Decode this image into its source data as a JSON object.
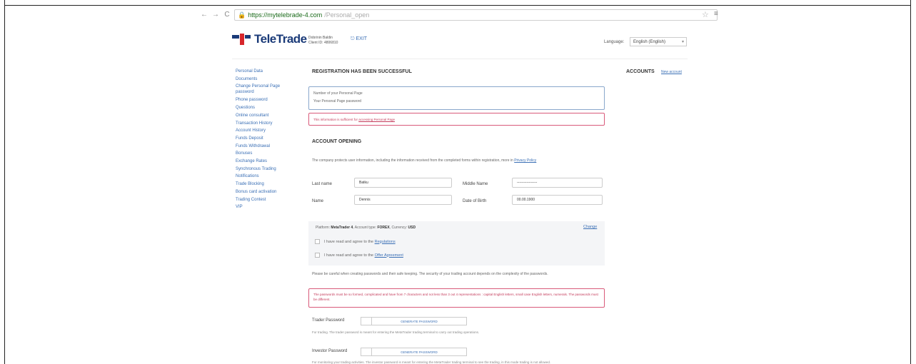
{
  "browser": {
    "back": "←",
    "forward": "→",
    "reload": "C",
    "url_host": "https://mytelebrade-4.com",
    "url_path": "/Personal_open",
    "star": "☆",
    "menu": "≡"
  },
  "header": {
    "logo_text": "TeleTrade",
    "user_line1": "Dobrinin Baldin",
    "user_line2": "Client ID: 4806810",
    "exit_label": "EXIT",
    "language_label": "Language:",
    "language_value": "English (English)"
  },
  "sidebar": {
    "items": [
      "Personal Data",
      "Documents",
      "Change Personal Page password",
      "Phone password",
      "Questions",
      "Online consultant",
      "Transaction History",
      "Account History",
      "Funds Deposit",
      "Funds Withdrawal",
      "Bonuses",
      "Exchange Rates",
      "Synchronous Trading",
      "Notifications",
      "Trade Blocking",
      "Bonus card activation",
      "Trading Contest",
      "VIP"
    ]
  },
  "main": {
    "registration_title": "REGISTRATION HAS BEEN SUCCESSFUL",
    "info_line1": "Number of your Personal Page",
    "info_line2": "Your Personal Page password",
    "alert_prefix": "This information is sufficient for ",
    "alert_link": "accessing Personal Page",
    "account_title": "ACCOUNT OPENING",
    "policy_prefix": "The company protects user information, including the information received from the completed forms within registration, more in ",
    "policy_link": "Privacy Policy",
    "last_name_label": "Last name",
    "last_name_value": "Batku",
    "middle_name_label": "Middle Name",
    "middle_name_value": "-----------------",
    "name_label": "Name",
    "name_value": "Dennis",
    "dob_label": "Date of Birth",
    "dob_value": "00.00.1900",
    "platform_prefix": "Platform: ",
    "platform_value": "MetaTrader 4",
    "account_type_prefix": ", Account type: ",
    "account_type_value": "FOREX",
    "currency_prefix": ", Currency: ",
    "currency_value": "USD",
    "change_label": "Change",
    "regulations_prefix": "I have read and agree to the ",
    "regulations_link": "Regulations",
    "offer_prefix": "I have read and agree to the ",
    "offer_link": "Offer Agreement",
    "pw_warning": "Please be careful when creating passwords and their safe keeping. The security of your trading account depends on the complexity of the passwords.",
    "pw_alert": "The passwords must be so formed, complicated and have from 7 characters and not less than 3 out 4 representations : capital English letters, small case English letters, numerals. The passwords must be different.",
    "trader_pw_label": "Trader Password",
    "generate_label": "Generate password",
    "trader_hint": "For trading. The trader password is meant for entering the MetaTrader trading terminal to carry out trading operations.",
    "investor_pw_label": "Investor Password",
    "investor_hint": "For monitoring your trading activities. The investor password is meant for entering the MetaTrader trading terminal to see the trading, in this mode trading is not allowed."
  },
  "right": {
    "accounts_title": "ACCOUNTS",
    "new_account": "New account"
  }
}
